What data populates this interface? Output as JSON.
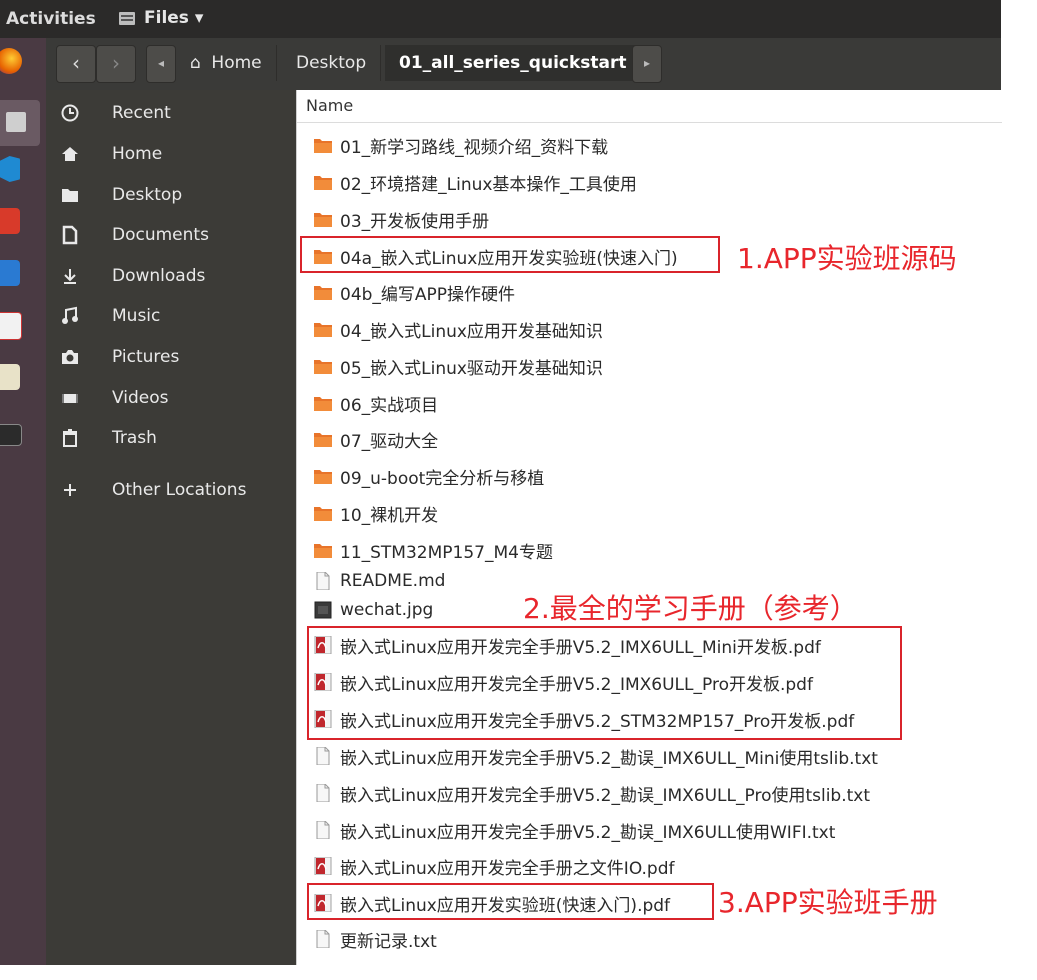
{
  "topbar": {
    "activities": "Activities",
    "app_menu": "Files ▾"
  },
  "header": {
    "back": "‹",
    "forward": "›",
    "left_arrow": "◂",
    "right_arrow": "▸",
    "crumbs": [
      "Home",
      "Desktop",
      "01_all_series_quickstart"
    ]
  },
  "sidebar": {
    "items": [
      {
        "label": "Recent",
        "icon": "clock-icon"
      },
      {
        "label": "Home",
        "icon": "home-icon"
      },
      {
        "label": "Desktop",
        "icon": "folder-icon"
      },
      {
        "label": "Documents",
        "icon": "document-icon"
      },
      {
        "label": "Downloads",
        "icon": "download-icon"
      },
      {
        "label": "Music",
        "icon": "music-icon"
      },
      {
        "label": "Pictures",
        "icon": "camera-icon"
      },
      {
        "label": "Videos",
        "icon": "video-icon"
      },
      {
        "label": "Trash",
        "icon": "trash-icon"
      },
      {
        "label": "Other Locations",
        "icon": "plus-icon"
      }
    ]
  },
  "main": {
    "column_header": "Name",
    "files": [
      {
        "name": "01_新学习路线_视频介绍_资料下载",
        "type": "folder"
      },
      {
        "name": "02_环境搭建_Linux基本操作_工具使用",
        "type": "folder"
      },
      {
        "name": "03_开发板使用手册",
        "type": "folder"
      },
      {
        "name": "04a_嵌入式Linux应用开发实验班(快速入门)",
        "type": "folder"
      },
      {
        "name": "04b_编写APP操作硬件",
        "type": "folder"
      },
      {
        "name": "04_嵌入式Linux应用开发基础知识",
        "type": "folder"
      },
      {
        "name": "05_嵌入式Linux驱动开发基础知识",
        "type": "folder"
      },
      {
        "name": "06_实战项目",
        "type": "folder"
      },
      {
        "name": "07_驱动大全",
        "type": "folder"
      },
      {
        "name": "09_u-boot完全分析与移植",
        "type": "folder"
      },
      {
        "name": "10_裸机开发",
        "type": "folder"
      },
      {
        "name": "11_STM32MP157_M4专题",
        "type": "folder"
      },
      {
        "name": "README.md",
        "type": "text"
      },
      {
        "name": "wechat.jpg",
        "type": "image"
      },
      {
        "name": "嵌入式Linux应用开发完全手册V5.2_IMX6ULL_Mini开发板.pdf",
        "type": "pdf"
      },
      {
        "name": "嵌入式Linux应用开发完全手册V5.2_IMX6ULL_Pro开发板.pdf",
        "type": "pdf"
      },
      {
        "name": "嵌入式Linux应用开发完全手册V5.2_STM32MP157_Pro开发板.pdf",
        "type": "pdf"
      },
      {
        "name": "嵌入式Linux应用开发完全手册V5.2_勘误_IMX6ULL_Mini使用tslib.txt",
        "type": "text"
      },
      {
        "name": "嵌入式Linux应用开发完全手册V5.2_勘误_IMX6ULL_Pro使用tslib.txt",
        "type": "text"
      },
      {
        "name": "嵌入式Linux应用开发完全手册V5.2_勘误_IMX6ULL使用WIFI.txt",
        "type": "text"
      },
      {
        "name": "嵌入式Linux应用开发完全手册之文件IO.pdf",
        "type": "pdf"
      },
      {
        "name": "嵌入式Linux应用开发实验班(快速入门).pdf",
        "type": "pdf"
      },
      {
        "name": "更新记录.txt",
        "type": "text"
      }
    ]
  },
  "annotations": {
    "note1": "1.APP实验班源码",
    "note2": "2.最全的学习手册（参考）",
    "note3": "3.APP实验班手册"
  },
  "colors": {
    "annotation_red": "#e8262c",
    "folder_orange": "#e8742a",
    "pdf_red": "#c0272d"
  }
}
